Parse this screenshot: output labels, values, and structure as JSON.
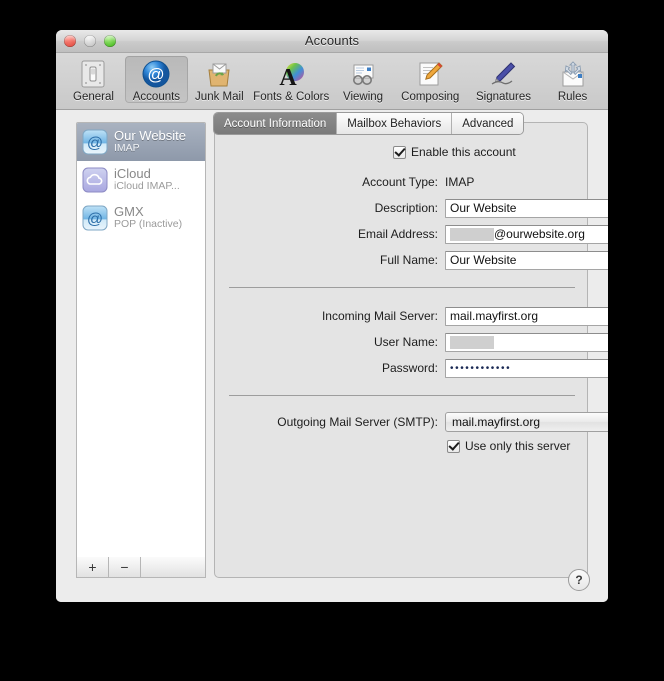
{
  "window": {
    "title": "Accounts",
    "traffic_lights": [
      "close-button",
      "minimize-button",
      "zoom-button"
    ]
  },
  "toolbar": {
    "items": [
      {
        "label": "General",
        "icon": "general-switch-icon",
        "selected": false
      },
      {
        "label": "Accounts",
        "icon": "accounts-at-icon",
        "selected": true
      },
      {
        "label": "Junk Mail",
        "icon": "junk-mail-bag-icon",
        "selected": false
      },
      {
        "label": "Fonts & Colors",
        "icon": "fonts-colors-a-icon",
        "selected": false
      },
      {
        "label": "Viewing",
        "icon": "viewing-glasses-icon",
        "selected": false
      },
      {
        "label": "Composing",
        "icon": "composing-pencil-icon",
        "selected": false
      },
      {
        "label": "Signatures",
        "icon": "signatures-pen-icon",
        "selected": false
      },
      {
        "label": "Rules",
        "icon": "rules-arrows-icon",
        "selected": false
      }
    ]
  },
  "sidebar": {
    "accounts": [
      {
        "name": "Our Website",
        "sub": "IMAP",
        "icon": "at-mail-icon",
        "selected": true
      },
      {
        "name": "iCloud",
        "sub": "iCloud IMAP...",
        "icon": "icloud-icon",
        "selected": false
      },
      {
        "name": "GMX",
        "sub": "POP (Inactive)",
        "icon": "at-mail-icon",
        "selected": false
      }
    ],
    "add_label": "+",
    "remove_label": "−"
  },
  "tabs": [
    {
      "label": "Account Information",
      "active": true
    },
    {
      "label": "Mailbox Behaviors",
      "active": false
    },
    {
      "label": "Advanced",
      "active": false
    }
  ],
  "form": {
    "enable_account": {
      "label": "Enable this account",
      "checked": true
    },
    "account_type": {
      "label": "Account Type:",
      "value": "IMAP"
    },
    "description": {
      "label": "Description:",
      "value": "Our Website"
    },
    "email_address": {
      "label": "Email Address:",
      "redacted": true,
      "value": "@ourwebsite.org"
    },
    "full_name": {
      "label": "Full Name:",
      "value": "Our Website"
    },
    "incoming_server": {
      "label": "Incoming Mail Server:",
      "value": "mail.mayfirst.org"
    },
    "user_name": {
      "label": "User Name:",
      "redacted": true,
      "value": ""
    },
    "password": {
      "label": "Password:",
      "value": "••••••••••••"
    },
    "outgoing_server": {
      "label": "Outgoing Mail Server (SMTP):",
      "value": "mail.mayfirst.org"
    },
    "use_only_this_server": {
      "label": "Use only this server",
      "checked": true
    }
  },
  "help": {
    "label": "?"
  },
  "colors": {
    "window_bg": "#ececec",
    "panel_bg": "#e4e4e4",
    "selection": "#8e99aa",
    "accent_blue": "#2f7fd1"
  }
}
